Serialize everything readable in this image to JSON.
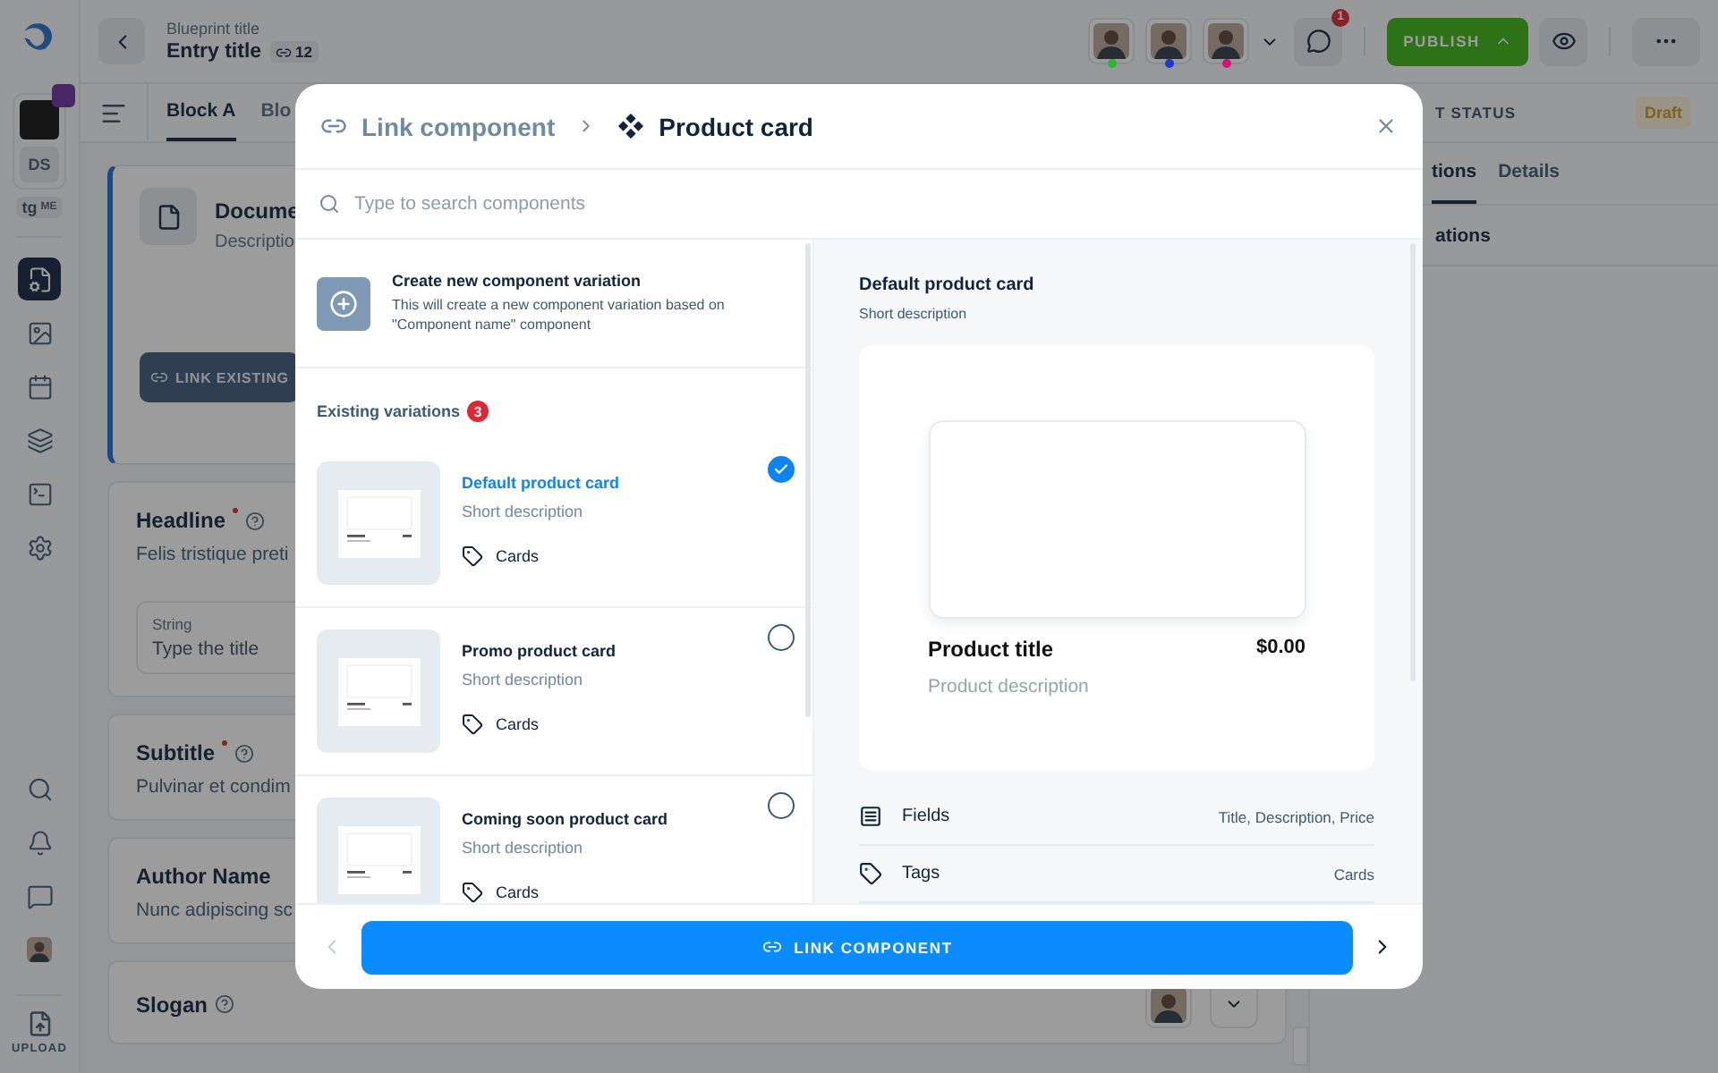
{
  "rail": {
    "workspace": {
      "label": "DS"
    },
    "personal": {
      "mark": "tg",
      "label": "ME"
    },
    "nav": [
      {
        "kind": "document",
        "selected": true
      },
      {
        "kind": "image",
        "selected": false
      },
      {
        "kind": "calendar",
        "selected": false
      },
      {
        "kind": "layers",
        "selected": false
      },
      {
        "kind": "terminal",
        "selected": false
      },
      {
        "kind": "settings",
        "selected": false
      }
    ],
    "bottom": [
      {
        "kind": "search"
      },
      {
        "kind": "bell"
      },
      {
        "kind": "chat"
      },
      {
        "kind": "avatar"
      }
    ],
    "upload": "UPLOAD"
  },
  "header": {
    "breadcrumb": "Blueprint title",
    "title": "Entry title",
    "link_count": "12",
    "collaborators": [
      {
        "color": "#2db52d"
      },
      {
        "color": "#1a3ad0"
      },
      {
        "color": "#d0127a"
      }
    ],
    "comment_badge": "1",
    "publish": "PUBLISH"
  },
  "tabs": [
    {
      "label": "Block A",
      "selected": true
    },
    {
      "label": "Blo",
      "selected": false
    }
  ],
  "document": {
    "title": "Docume",
    "description": "Descriptio",
    "button": "LINK EXISTING"
  },
  "fields": [
    {
      "label": "Headline",
      "required": true,
      "help": true,
      "value": "Felis tristique preti",
      "input": {
        "type": "String",
        "placeholder": "Type the title"
      }
    },
    {
      "label": "Subtitle",
      "required": true,
      "help": true,
      "value": "Pulvinar et condim"
    },
    {
      "label": "Author Name",
      "required": false,
      "help": false,
      "value": "Nunc adipiscing sc"
    },
    {
      "label": "Slogan",
      "required": false,
      "help": true,
      "avatar": true
    }
  ],
  "side_panel": {
    "status_label": "T STATUS",
    "status": "Draft",
    "tabs": [
      {
        "label": "tions",
        "selected": true
      },
      {
        "label": "Details",
        "selected": false
      }
    ],
    "section": "ations"
  },
  "modal": {
    "breadcrumb": "Link component",
    "title": "Product card",
    "search": {
      "placeholder": "Type to search components"
    },
    "create": {
      "title": "Create new component variation",
      "description": "This will create a new component variation based on \"Component name\" component"
    },
    "existing_label": "Existing variations",
    "existing_count": "3",
    "variations": [
      {
        "title": "Default product card",
        "description": "Short description",
        "tag": "Cards",
        "selected": true
      },
      {
        "title": "Promo product card",
        "description": "Short description",
        "tag": "Cards",
        "selected": false
      },
      {
        "title": "Coming soon product card",
        "description": "Short description",
        "tag": "Cards",
        "selected": false
      }
    ],
    "preview": {
      "title": "Default product card",
      "description": "Short description",
      "product_title": "Product title",
      "price": "$0.00",
      "product_description": "Product description"
    },
    "properties": [
      {
        "kind": "fields",
        "label": "Fields",
        "value": "Title, Description, Price"
      },
      {
        "kind": "tags",
        "label": "Tags",
        "value": "Cards"
      }
    ],
    "button": "LINK COMPONENT"
  }
}
